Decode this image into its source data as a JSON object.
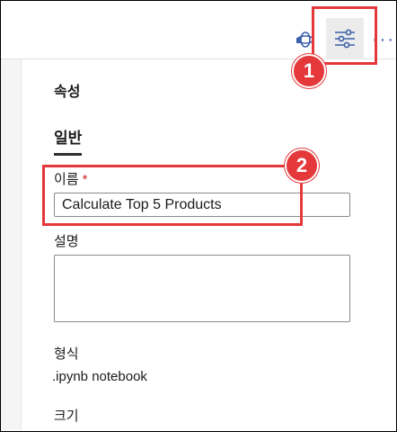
{
  "toolbar": {
    "icons": [
      "notebook-session-icon",
      "properties-icon",
      "more-options-icon"
    ],
    "more_glyph": "···"
  },
  "callouts": {
    "badge_1": "1",
    "badge_2": "2",
    "color": "#e5383b"
  },
  "properties_panel": {
    "title": "속성",
    "tab_general": "일반",
    "name_label": "이름",
    "required_mark": "*",
    "name_value": "Calculate Top 5 Products",
    "description_label": "설명",
    "description_value": "",
    "format_label": "형식",
    "format_value": ".ipynb notebook",
    "size_label": "크기"
  }
}
